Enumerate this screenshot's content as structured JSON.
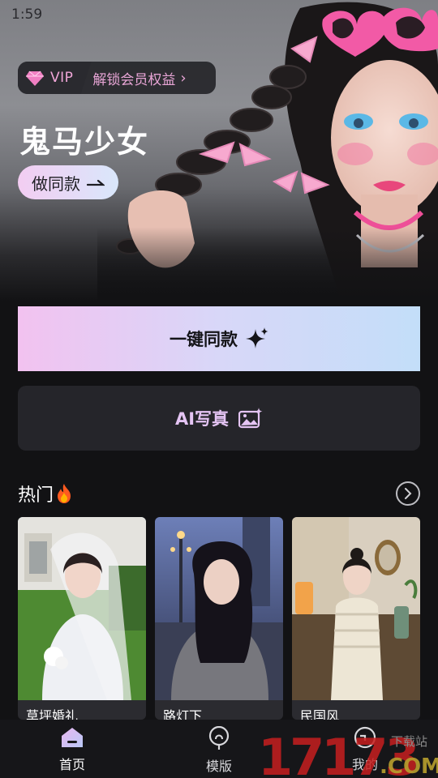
{
  "status_bar": {
    "time": "1:59"
  },
  "hero": {
    "vip_badge": "VIP",
    "vip_link": "解锁会员权益",
    "title": "鬼马少女",
    "make_same_button": "做同款"
  },
  "actions": {
    "one_click_button": "一键同款",
    "ai_photo_button": "AI写真"
  },
  "hot": {
    "title": "热门",
    "cards": [
      {
        "label": "草坪婚礼"
      },
      {
        "label": "路灯下"
      },
      {
        "label": "民国风"
      }
    ]
  },
  "bottom_nav": {
    "items": [
      {
        "label": "首页",
        "icon": "home-icon",
        "active": true
      },
      {
        "label": "模版",
        "icon": "template-icon",
        "active": false
      },
      {
        "label": "我的",
        "icon": "profile-icon",
        "active": false
      }
    ]
  },
  "watermark": {
    "number": "17173",
    "site_text": "下载站",
    "domain": ".COM"
  },
  "colors": {
    "accent_pink": "#f2c2f0",
    "accent_blue": "#c3def9",
    "background": "#121214",
    "vip_text": "#f0a6d8"
  }
}
